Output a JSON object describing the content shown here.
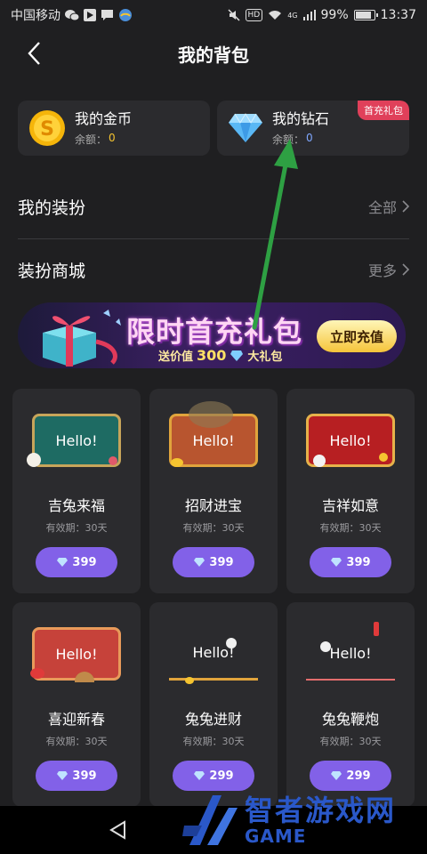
{
  "status_bar": {
    "carrier": "中国移动",
    "signal_type": "4G",
    "battery": "99%",
    "time": "13:37"
  },
  "header": {
    "title": "我的背包"
  },
  "wallet": {
    "coin": {
      "title": "我的金币",
      "balance_label": "余额：",
      "balance": "0"
    },
    "diamond": {
      "title": "我的钻石",
      "balance_label": "余额：",
      "balance": "0",
      "badge": "首充礼包"
    }
  },
  "rows": [
    {
      "label": "我的装扮",
      "action": "全部"
    },
    {
      "label": "装扮商城",
      "action": "更多"
    }
  ],
  "banner": {
    "title": "限时首充礼包",
    "sub_prefix": "送价值",
    "sub_value": "300",
    "sub_suffix": "大礼包",
    "button": "立即充值"
  },
  "items": [
    {
      "frame_text": "Hello!",
      "name": "吉兔来福",
      "validity": "有效期：30天",
      "price": "399"
    },
    {
      "frame_text": "Hello!",
      "name": "招财进宝",
      "validity": "有效期：30天",
      "price": "399"
    },
    {
      "frame_text": "Hello!",
      "name": "吉祥如意",
      "validity": "有效期：30天",
      "price": "399"
    },
    {
      "frame_text": "Hello!",
      "name": "喜迎新春",
      "validity": "有效期：30天",
      "price": "399"
    },
    {
      "frame_text": "Hello!",
      "name": "兔兔进财",
      "validity": "有效期：30天",
      "price": "299"
    },
    {
      "frame_text": "Hello!",
      "name": "兔兔鞭炮",
      "validity": "有效期：30天",
      "price": "299"
    }
  ],
  "watermark": {
    "cn": "智者游戏网",
    "en": "GAME"
  },
  "colors": {
    "background": "#1f1f21",
    "card": "#2b2b2e",
    "button_purple": "#8261e8",
    "coin_gold": "#f5c430",
    "badge_red": "#e0405a",
    "arrow_green": "#2ea043"
  }
}
